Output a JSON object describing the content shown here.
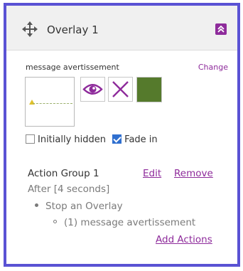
{
  "header": {
    "title": "Overlay 1",
    "move_icon": "move-arrows-icon",
    "collapse_icon": "double-chevron-up-icon"
  },
  "media": {
    "name": "message avertissement",
    "change_label": "Change",
    "swatch_color": "#557a2c"
  },
  "tools": {
    "eye_icon": "eye-icon",
    "delete_icon": "close-x-icon"
  },
  "options": {
    "initially_hidden": {
      "label": "Initially hidden",
      "checked": false
    },
    "fade_in": {
      "label": "Fade in",
      "checked": true
    }
  },
  "action_group": {
    "title": "Action Group 1",
    "edit_label": "Edit",
    "remove_label": "Remove",
    "trigger": "After [4 seconds]",
    "action": "Stop an Overlay",
    "target": "(1) message avertissement",
    "add_actions_label": "Add Actions"
  },
  "colors": {
    "accent": "#8e2b9b",
    "frame": "#5a52d4",
    "checkbox": "#2f6fcf"
  }
}
